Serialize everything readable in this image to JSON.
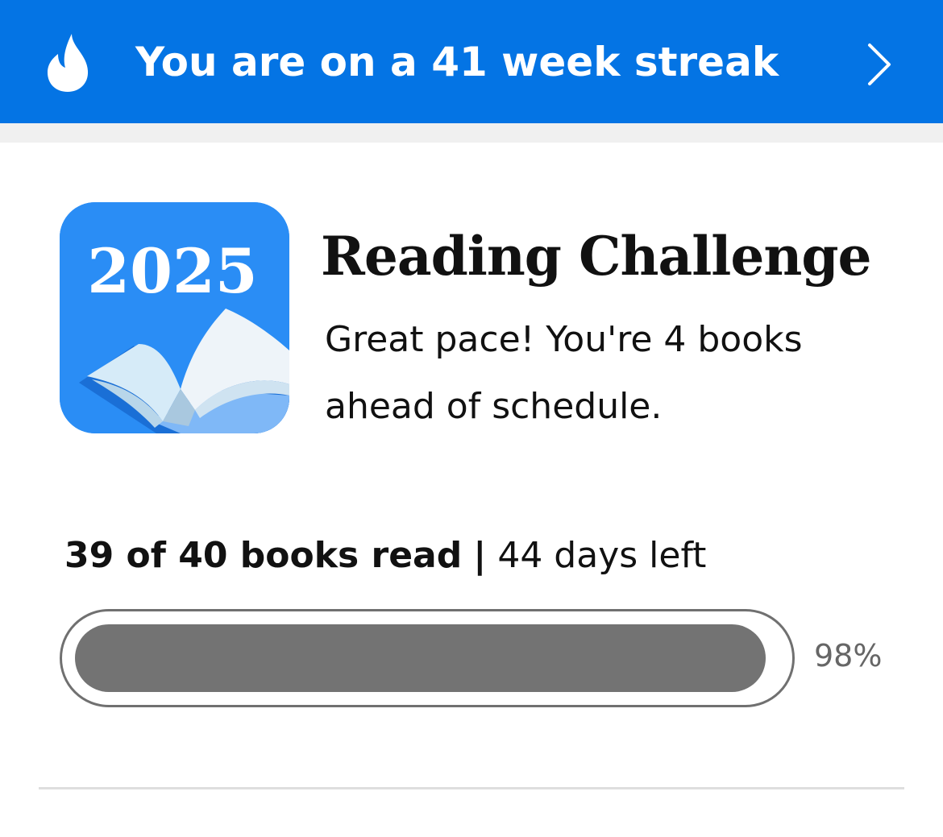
{
  "streak": {
    "text": "You are on a 41 week streak",
    "icon": "flame-icon",
    "action_icon": "chevron-right-icon",
    "background": "#0474e4"
  },
  "challenge": {
    "badge_year": "2025",
    "badge_icon": "open-book-icon",
    "title": "Reading Challenge",
    "message": "Great pace! You're 4 books ahead of schedule."
  },
  "progress": {
    "books_read_text": "39 of 40 books read",
    "separator": "|",
    "days_left_text": "44 days left",
    "percent_label": "98%",
    "fraction": 0.98
  }
}
